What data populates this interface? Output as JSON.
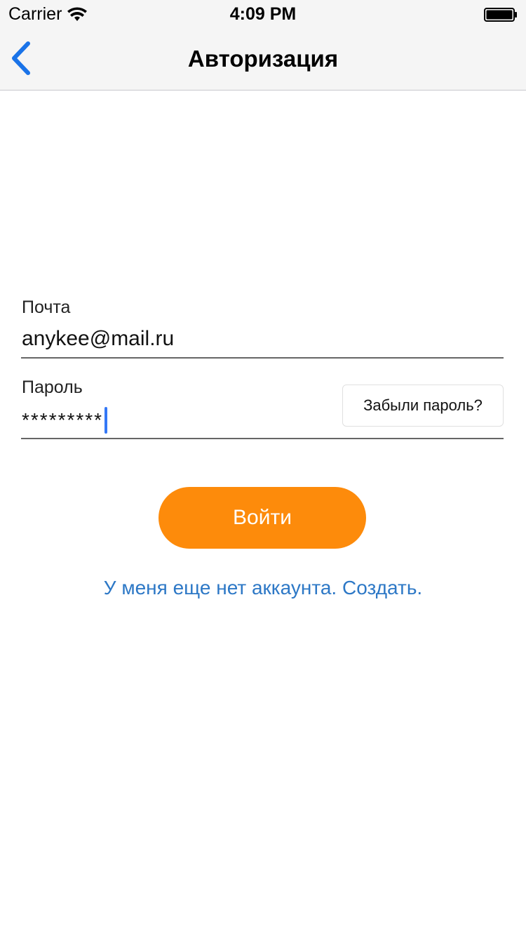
{
  "status_bar": {
    "carrier": "Carrier",
    "time": "4:09 PM",
    "wifi_icon": "wifi-icon",
    "battery_icon": "battery-icon"
  },
  "nav": {
    "title": "Авторизация",
    "back_icon": "chevron-left-icon",
    "accent_color": "#1a73e8"
  },
  "form": {
    "email_label": "Почта",
    "email_value": "anykee@mail.ru",
    "password_label": "Пароль",
    "password_value": "*********",
    "forgot_label": "Забыли пароль?"
  },
  "actions": {
    "login_label": "Войти",
    "login_color": "#fd8b0b",
    "create_account_label": "У меня еще нет аккаунта. Создать.",
    "link_color": "#2d78c6"
  }
}
